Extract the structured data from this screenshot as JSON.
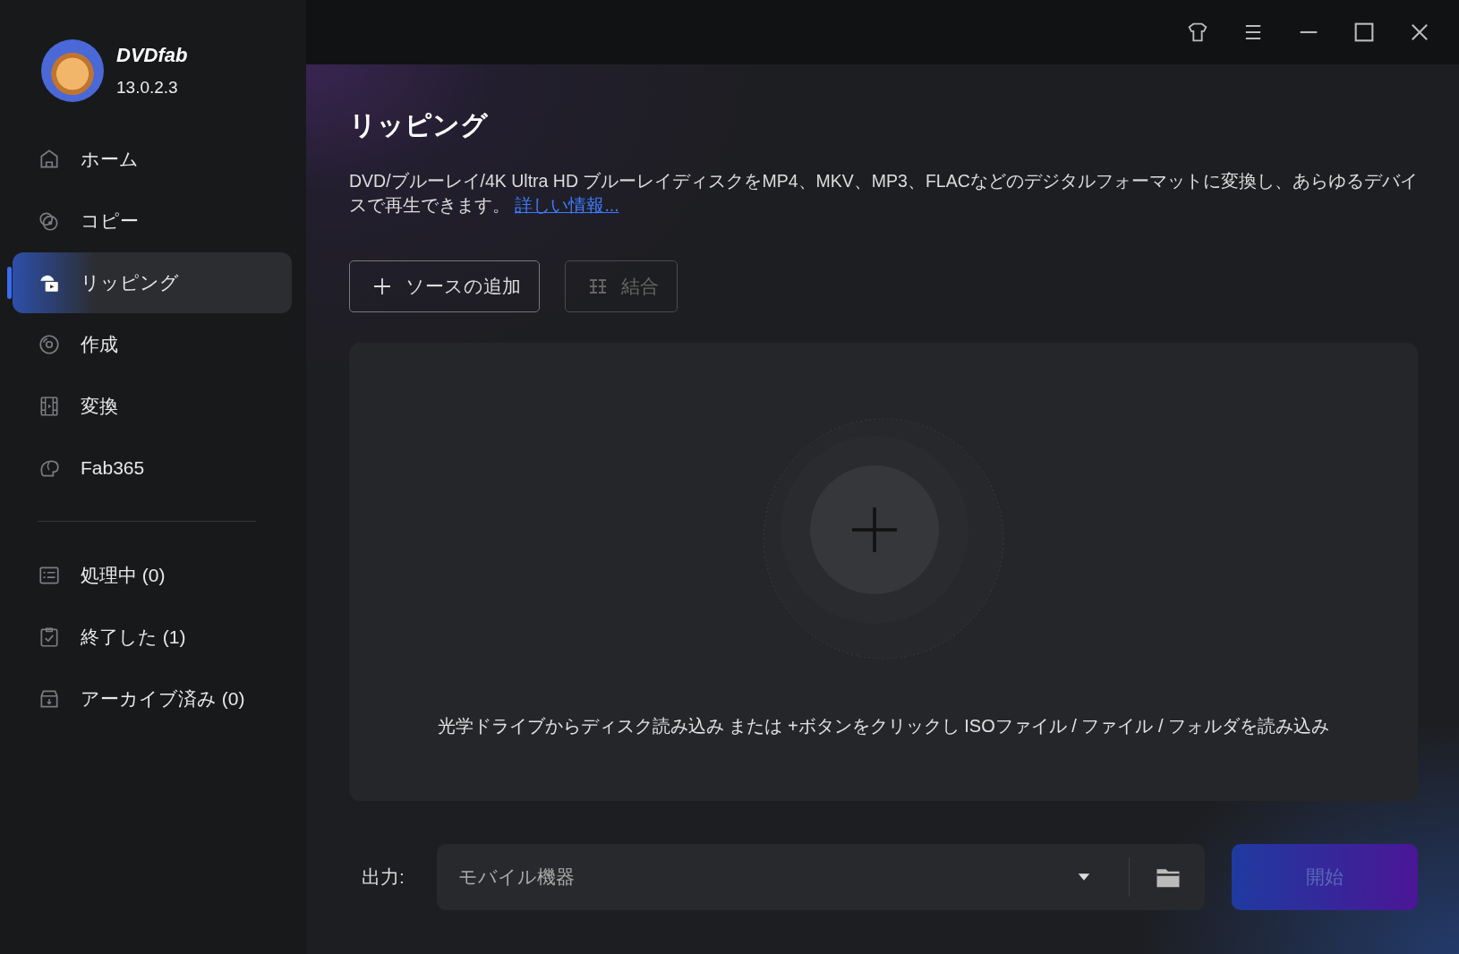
{
  "app": {
    "name": "DVDfab",
    "version": "13.0.2.3"
  },
  "nav": [
    {
      "label": "ホーム",
      "selected": false
    },
    {
      "label": "コピー",
      "selected": false
    },
    {
      "label": "リッピング",
      "selected": true
    },
    {
      "label": "作成",
      "selected": false
    },
    {
      "label": "変換",
      "selected": false
    },
    {
      "label": "Fab365",
      "selected": false
    }
  ],
  "tasks": [
    {
      "label": "処理中 (0)"
    },
    {
      "label": "終了した (1)"
    },
    {
      "label": "アーカイブ済み (0)"
    }
  ],
  "page": {
    "title": "リッピング",
    "description": "DVD/ブルーレイ/4K Ultra HD ブルーレイディスクをMP4、MKV、MP3、FLACなどのデジタルフォーマットに変換し、あらゆるデバイスで再生できます。",
    "link": "詳しい情報..."
  },
  "toolbar": [
    {
      "label": "ソースの追加",
      "disabled": false
    },
    {
      "label": "結合",
      "disabled": true
    }
  ],
  "dropzone": {
    "hint": "光学ドライブからディスク読み込み または +ボタンをクリックし ISOファイル / ファイル / フォルダを読み込み"
  },
  "output": {
    "label": "出力:",
    "value": "モバイル機器"
  },
  "start_button": {
    "label": "開始",
    "disabled": true
  }
}
